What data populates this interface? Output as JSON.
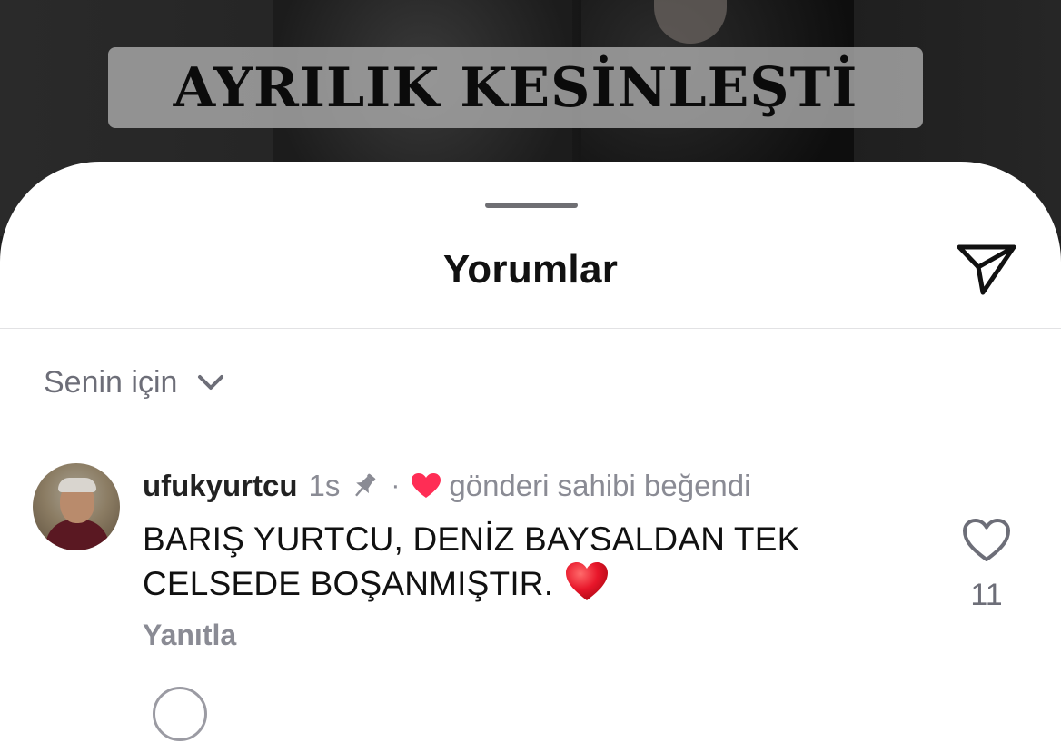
{
  "background": {
    "headline": "AYRILIK KESİNLEŞTİ"
  },
  "sheet": {
    "title": "Yorumlar",
    "share_icon": "paper-plane-icon",
    "sort": {
      "label": "Senin için",
      "icon": "chevron-down-icon"
    }
  },
  "comment": {
    "username": "ufukyurtcu",
    "time": "1s",
    "separator": "·",
    "pin_icon": "pin-icon",
    "liked_by_author_icon": "heart-icon",
    "liked_by_author_text": "gönderi sahibi beğendi",
    "text": "BARIŞ YURTCU, DENİZ BAYSALDAN TEK CELSEDE BOŞANMIŞTIR.",
    "emoji": "red-heart-emoji",
    "reply_label": "Yanıtla",
    "like_icon": "heart-outline-icon",
    "like_count": "11"
  },
  "colors": {
    "accent_heart": "#ff2d55",
    "secondary_text": "#8a8b94",
    "primary_text": "#111111"
  }
}
